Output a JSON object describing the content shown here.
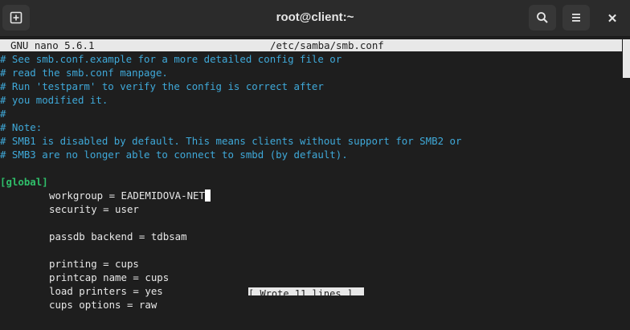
{
  "window": {
    "title": "root@client:~",
    "new_tab_icon": "new-tab-icon",
    "search_icon": "search-icon",
    "menu_icon": "hamburger-menu-icon",
    "close_label": "✕"
  },
  "nano": {
    "version": "GNU nano 5.6.1",
    "filename": "/etc/samba/smb.conf",
    "bottom_message": "[ Wrote 11 lines ]"
  },
  "lines": [
    "# See smb.conf.example for a more detailed config file or",
    "# read the smb.conf manpage.",
    "# Run 'testparm' to verify the config is correct after",
    "# you modified it.",
    "#",
    "# Note:",
    "# SMB1 is disabled by default. This means clients without support for SMB2 or",
    "# SMB3 are no longer able to connect to smbd (by default).",
    "",
    "[global]",
    "workgroup = EADEMIDOVA-NET",
    "security = user",
    "",
    "passdb backend = tdbsam",
    "",
    "printing = cups",
    "printcap name = cups",
    "load printers = yes",
    "cups options = raw"
  ],
  "colors": {
    "comment": "#3fa9d9",
    "section": "#2fbf6a",
    "text": "#e8e8e8",
    "background": "#1e1e1e"
  }
}
